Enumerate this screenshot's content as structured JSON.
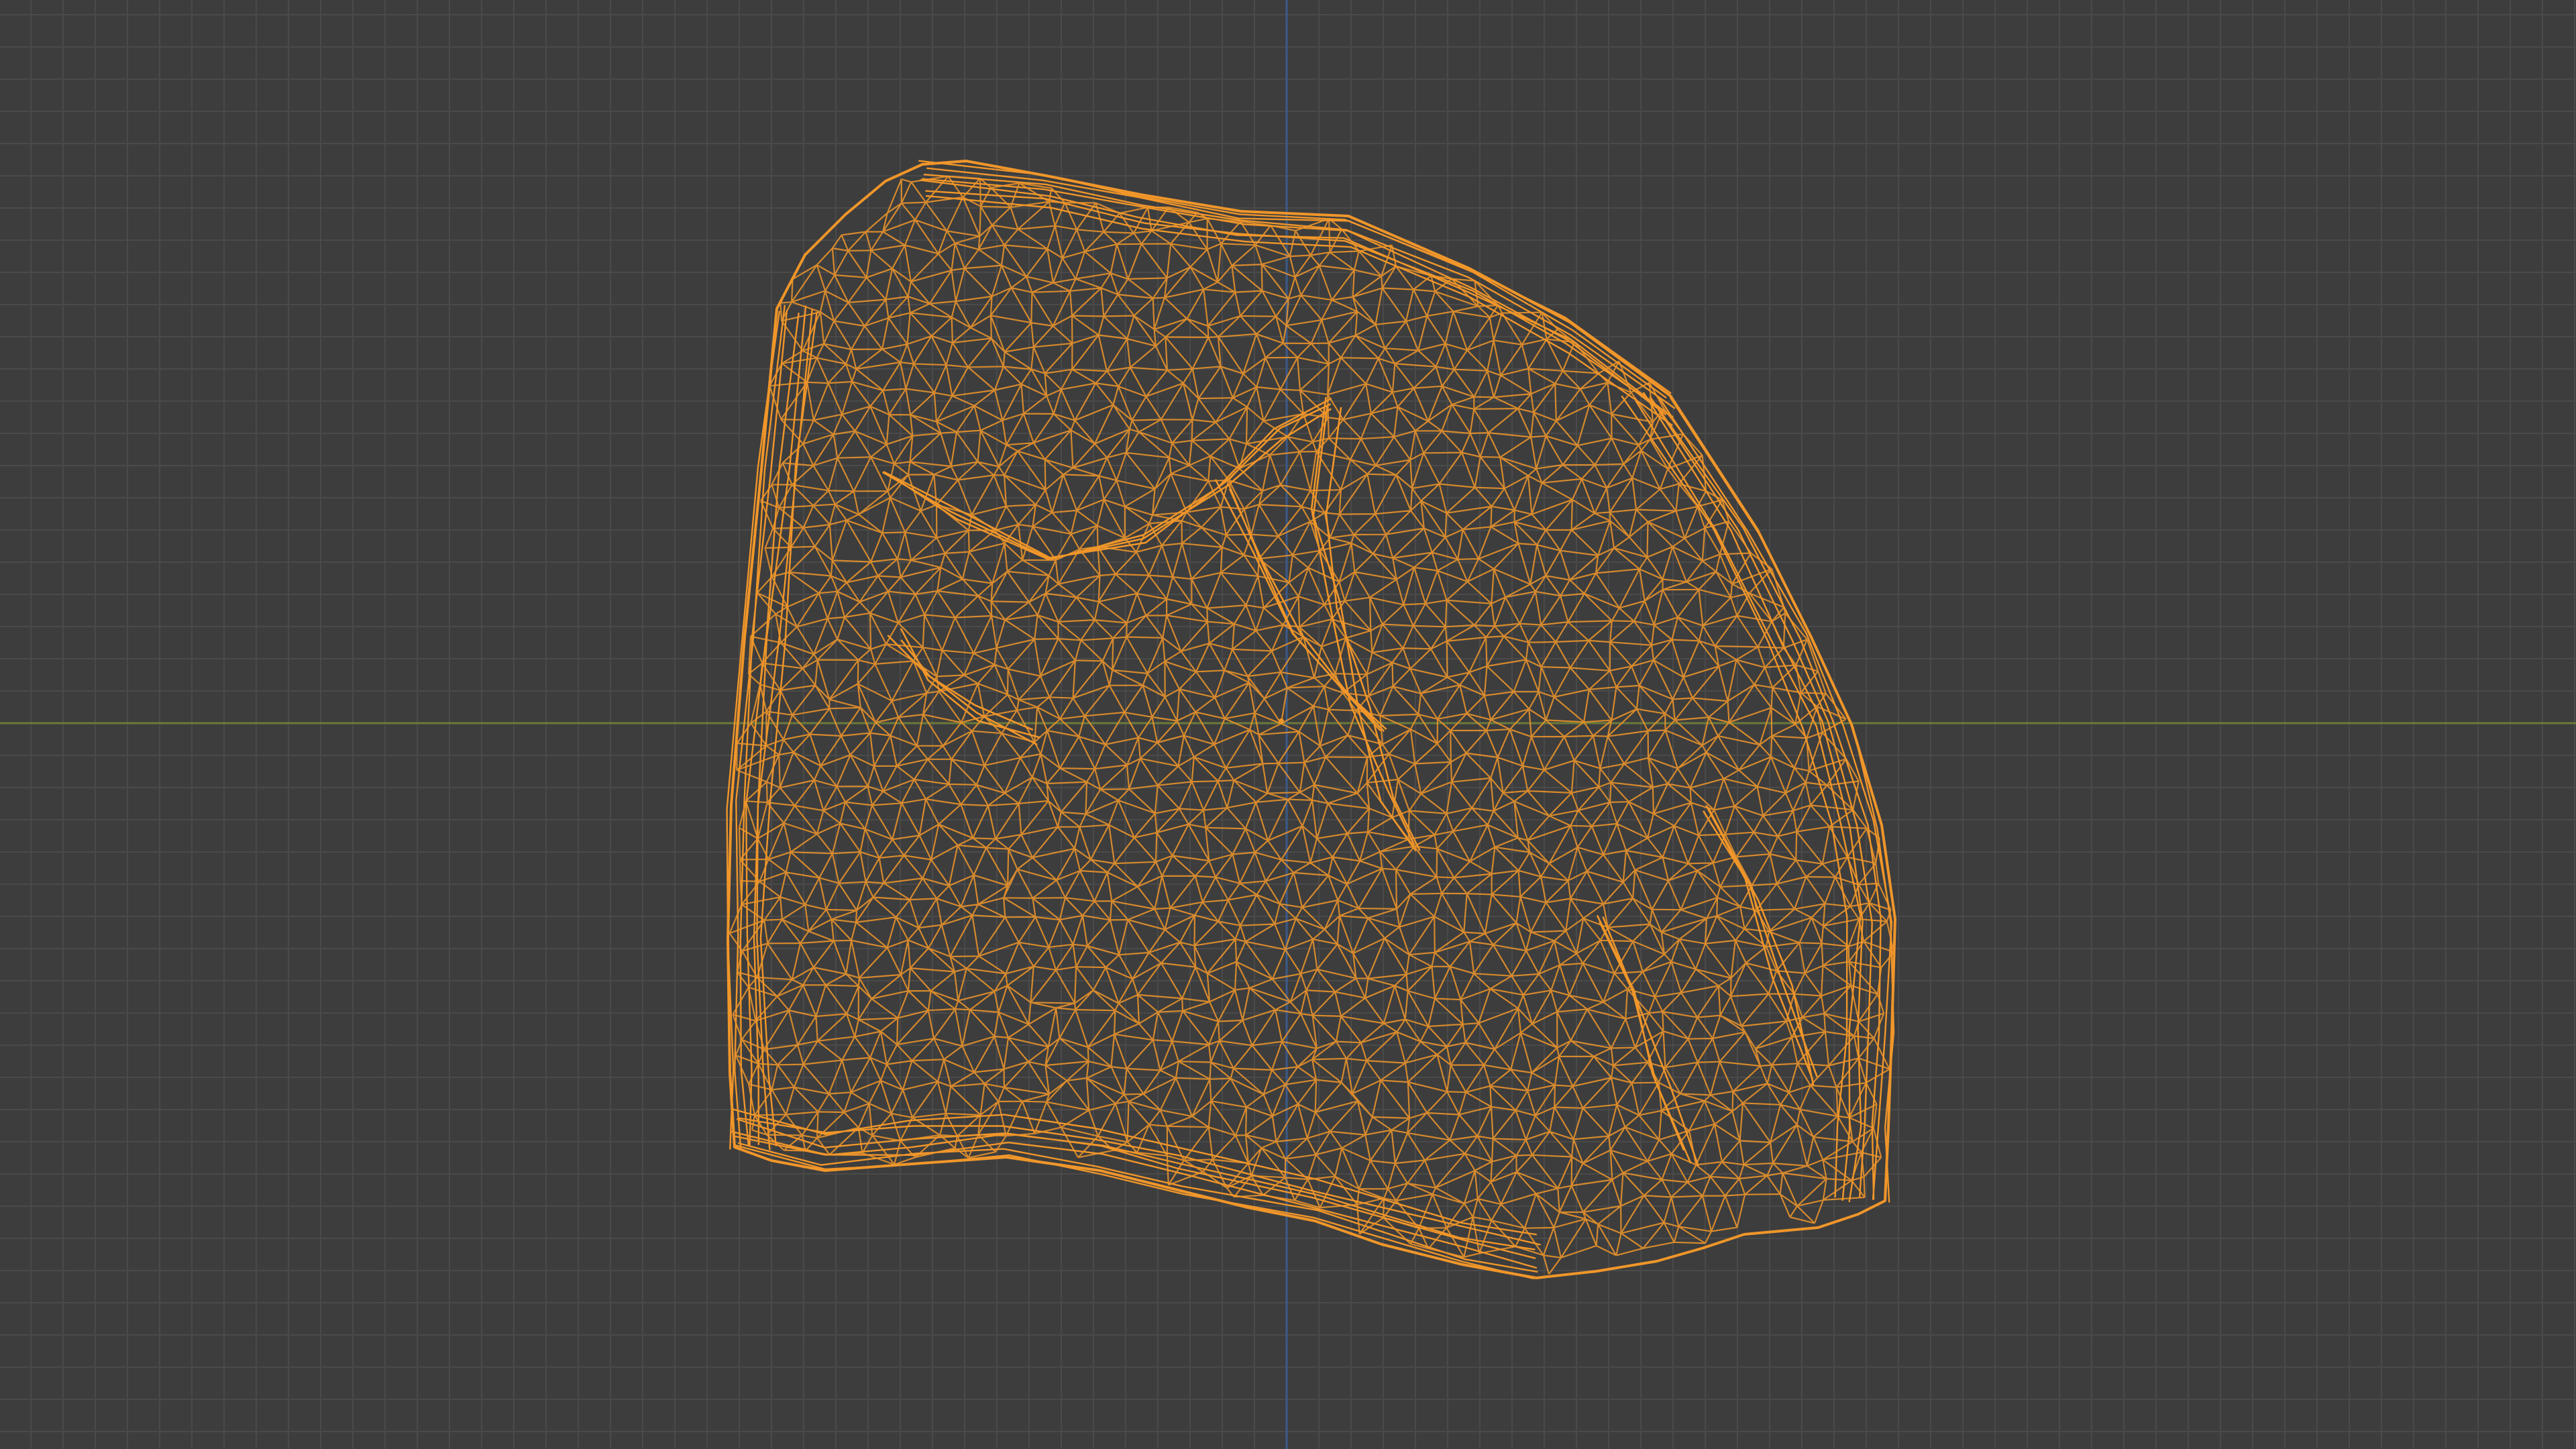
{
  "viewport": {
    "background_color": "#3d3d3d",
    "grid_color": "#4a4a4a",
    "grid_major_color": "#525252",
    "x_axis_color": "#6b7a3a",
    "y_axis_color": "#3a5a8a"
  },
  "object": {
    "name": "rock",
    "display_mode": "wireframe",
    "wire_color": "#f0962a",
    "selected": true
  }
}
